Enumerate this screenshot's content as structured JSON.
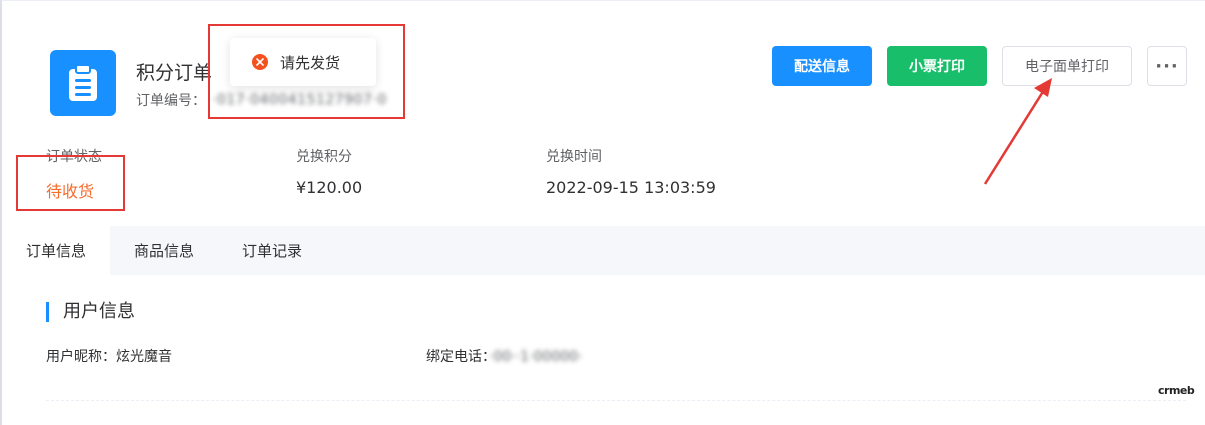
{
  "header": {
    "title": "积分订单",
    "order_no_label": "订单编号：",
    "order_no_value": "·017·0400415127907·0"
  },
  "actions": {
    "delivery_info": "配送信息",
    "receipt_print": "小票打印",
    "e_waybill_print": "电子面单打印",
    "more": "···"
  },
  "stats": [
    {
      "label": "订单状态",
      "value": "待收货"
    },
    {
      "label": "兑换积分",
      "value": "¥120.00"
    },
    {
      "label": "兑换时间",
      "value": "2022-09-15 13:03:59"
    }
  ],
  "tabs": [
    {
      "label": "订单信息",
      "active": true
    },
    {
      "label": "商品信息",
      "active": false
    },
    {
      "label": "订单记录",
      "active": false
    }
  ],
  "user_section": {
    "title": "用户信息",
    "nickname_label": "用户昵称：",
    "nickname_value": "炫光魔音",
    "phone_label": "绑定电话：",
    "phone_value": "·00··1·00000·"
  },
  "toast": {
    "message": "请先发货"
  },
  "watermark": "crmeb",
  "colors": {
    "primary": "#1890ff",
    "success": "#19be6b",
    "status": "#f56c2d",
    "annotation": "#e53935",
    "error": "#f4511e"
  }
}
